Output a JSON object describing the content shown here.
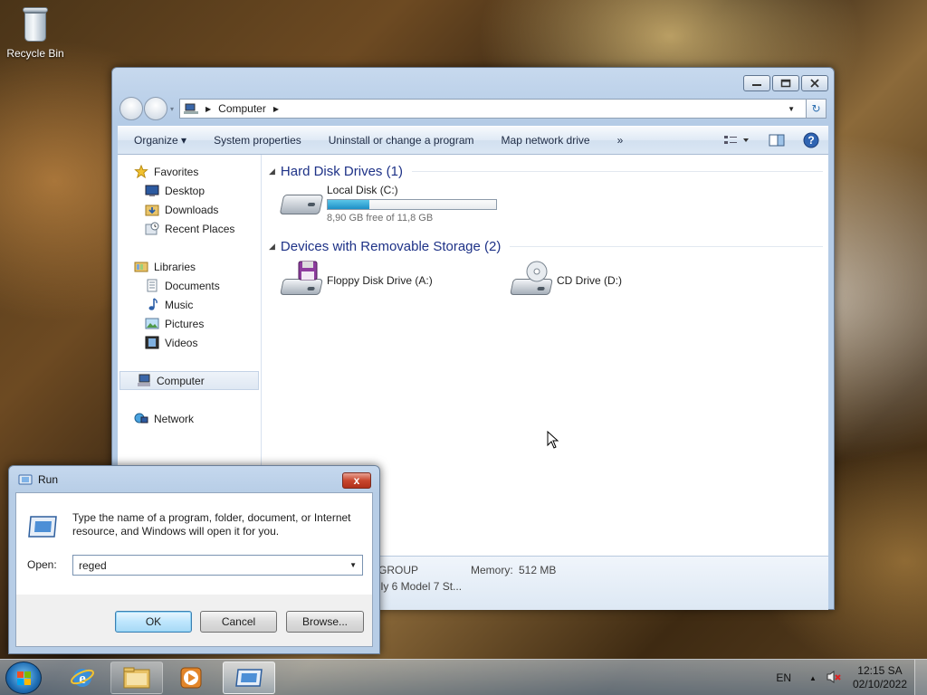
{
  "desktop": {
    "recycle_bin_label": "Recycle Bin"
  },
  "explorer": {
    "address": {
      "segments": [
        "Computer"
      ]
    },
    "toolbar": {
      "organize": "Organize",
      "system_properties": "System properties",
      "uninstall": "Uninstall or change a program",
      "map_drive": "Map network drive",
      "more": "»"
    },
    "nav": {
      "favorites": "Favorites",
      "desktop": "Desktop",
      "downloads": "Downloads",
      "recent_places": "Recent Places",
      "libraries": "Libraries",
      "documents": "Documents",
      "music": "Music",
      "pictures": "Pictures",
      "videos": "Videos",
      "computer": "Computer",
      "network": "Network"
    },
    "groups": {
      "hdd": "Hard Disk Drives (1)",
      "removable": "Devices with Removable Storage (2)"
    },
    "drives": {
      "c": {
        "name": "Local Disk (C:)",
        "free_text": "8,90 GB free of 11,8 GB",
        "used_fraction": 0.246
      },
      "a": {
        "name": "Floppy Disk Drive (A:)"
      },
      "d": {
        "name": "CD Drive (D:)"
      }
    },
    "details": {
      "workgroup_partial": "GROUP",
      "memory_label": "Memory:",
      "memory_value": "512 MB",
      "processor_partial": "ily 6 Model 7 St..."
    }
  },
  "run_dialog": {
    "title": "Run",
    "close": "x",
    "description": "Type the name of a program, folder, document, or Internet resource, and Windows will open it for you.",
    "open_label": "Open:",
    "open_value": "reged",
    "ok": "OK",
    "cancel": "Cancel",
    "browse": "Browse..."
  },
  "taskbar": {
    "language": "EN",
    "time": "12:15 SA",
    "date": "02/10/2022"
  }
}
